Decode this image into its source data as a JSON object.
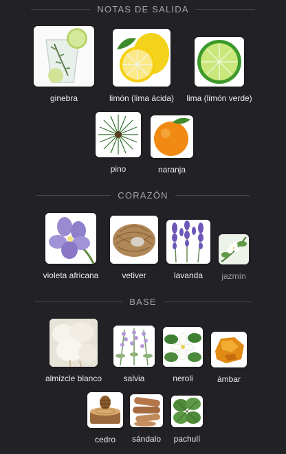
{
  "sections": {
    "top": {
      "title": "NOTAS DE SALIDA"
    },
    "heart": {
      "title": "CORAZÓN"
    },
    "base": {
      "title": "BASE"
    }
  },
  "notes": {
    "ginebra": "ginebra",
    "limon": "limón (lima ácida)",
    "lima": "lima (limón verde)",
    "pino": "pino",
    "naranja": "naranja",
    "violeta": "violeta africana",
    "vetiver": "vetiver",
    "lavanda": "lavanda",
    "jazmin": "jazmín",
    "almizcle": "almizcle blanco",
    "salvia": "salvia",
    "neroli": "neroli",
    "ambar": "ámbar",
    "cedro": "cedro",
    "sandalo": "sándalo",
    "pachuli": "pachulí"
  },
  "colors": {
    "background": "#222125",
    "label": "#ececec",
    "label_dim": "#9f9ea2",
    "section_title": "#a6a5a9"
  }
}
